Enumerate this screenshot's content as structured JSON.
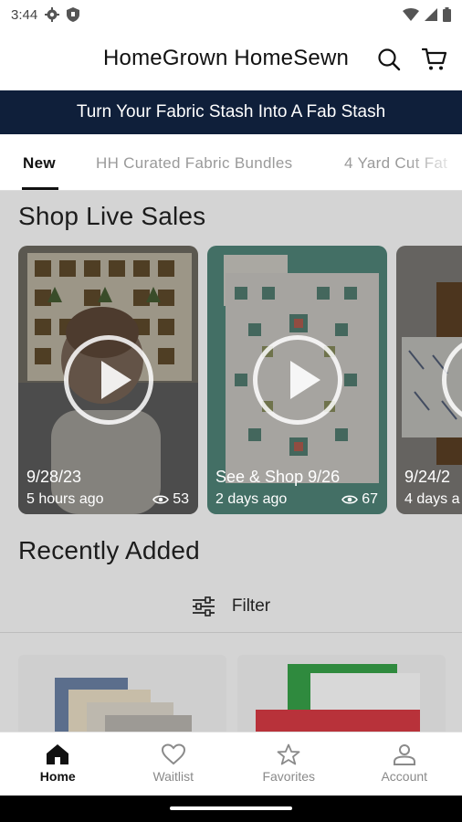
{
  "status_bar": {
    "time": "3:44"
  },
  "header": {
    "title": "HomeGrown HomeSewn"
  },
  "banner": {
    "text": "Turn Your Fabric Stash Into A Fab Stash"
  },
  "tabs": [
    {
      "label": "New",
      "active": true
    },
    {
      "label": "HH Curated Fabric Bundles",
      "active": false
    },
    {
      "label": "4 Yard Cut Fat",
      "active": false
    }
  ],
  "live_sales": {
    "title": "Shop Live Sales",
    "videos": [
      {
        "date": "9/28/23",
        "ago": "5 hours ago",
        "views": "53"
      },
      {
        "date": "See & Shop 9/26",
        "ago": "2 days ago",
        "views": "67"
      },
      {
        "date": "9/24/2",
        "ago": "4 days a",
        "views": ""
      }
    ]
  },
  "recently_added": {
    "title": "Recently Added",
    "filter_label": "Filter"
  },
  "bottom_nav": [
    {
      "label": "Home",
      "icon": "home-icon",
      "active": true
    },
    {
      "label": "Waitlist",
      "icon": "heart-icon",
      "active": false
    },
    {
      "label": "Favorites",
      "icon": "star-icon",
      "active": false
    },
    {
      "label": "Account",
      "icon": "person-icon",
      "active": false
    }
  ],
  "colors": {
    "banner_bg": "#0f1f3a",
    "overlay": "#d4d4d4",
    "teal": "#5e9a8c"
  }
}
